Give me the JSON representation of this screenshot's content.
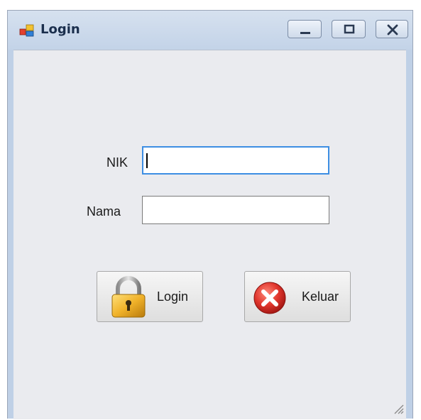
{
  "window": {
    "title": "Login",
    "controls": {
      "minimize": "minimize",
      "maximize": "maximize",
      "close": "close"
    }
  },
  "form": {
    "nik": {
      "label": "NIK",
      "value": ""
    },
    "nama": {
      "label": "Nama",
      "value": ""
    }
  },
  "buttons": {
    "login": {
      "label": "Login",
      "icon": "padlock-icon"
    },
    "keluar": {
      "label": "Keluar",
      "icon": "close-circle-icon"
    }
  },
  "colors": {
    "focus_border": "#3d8ee3",
    "close_icon_red": "#d9302b",
    "padlock_gold": "#e8a81c"
  }
}
